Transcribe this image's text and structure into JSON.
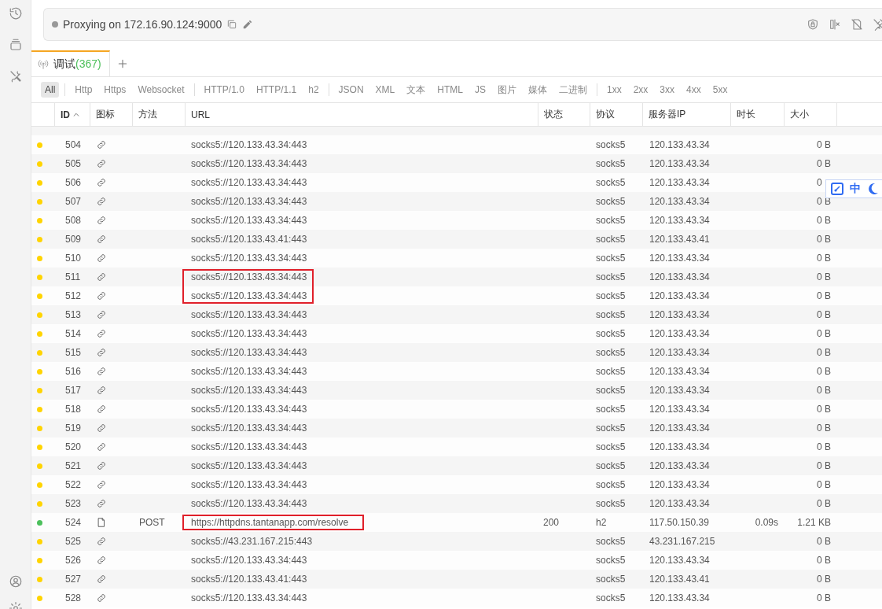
{
  "proxy_bar": {
    "status": "Proxying on 172.16.90.124:9000"
  },
  "tabs": [
    {
      "label": "调试",
      "count": "(367)",
      "selected": true
    }
  ],
  "filters": [
    {
      "separator": false,
      "label": "All",
      "selected": true
    },
    {
      "separator": true,
      "label": "Http",
      "selected": false
    },
    {
      "separator": false,
      "label": "Https",
      "selected": false
    },
    {
      "separator": false,
      "label": "Websocket",
      "selected": false
    },
    {
      "separator": true,
      "label": "HTTP/1.0",
      "selected": false
    },
    {
      "separator": false,
      "label": "HTTP/1.1",
      "selected": false
    },
    {
      "separator": false,
      "label": "h2",
      "selected": false
    },
    {
      "separator": true,
      "label": "JSON",
      "selected": false
    },
    {
      "separator": false,
      "label": "XML",
      "selected": false
    },
    {
      "separator": false,
      "label": "文本",
      "selected": false
    },
    {
      "separator": false,
      "label": "HTML",
      "selected": false
    },
    {
      "separator": false,
      "label": "JS",
      "selected": false
    },
    {
      "separator": false,
      "label": "图片",
      "selected": false
    },
    {
      "separator": false,
      "label": "媒体",
      "selected": false
    },
    {
      "separator": false,
      "label": "二进制",
      "selected": false
    },
    {
      "separator": true,
      "label": "1xx",
      "selected": false
    },
    {
      "separator": false,
      "label": "2xx",
      "selected": false
    },
    {
      "separator": false,
      "label": "3xx",
      "selected": false
    },
    {
      "separator": false,
      "label": "4xx",
      "selected": false
    },
    {
      "separator": false,
      "label": "5xx",
      "selected": false
    }
  ],
  "table": {
    "columns": [
      {
        "label": "ID",
        "sorted": true
      },
      {
        "label": "图标",
        "sorted": false
      },
      {
        "label": "方法",
        "sorted": false
      },
      {
        "label": "URL",
        "sorted": false
      },
      {
        "label": "状态",
        "sorted": false
      },
      {
        "label": "协议",
        "sorted": false
      },
      {
        "label": "服务器IP",
        "sorted": false
      },
      {
        "label": "时长",
        "sorted": false
      },
      {
        "label": "大小",
        "sorted": false
      }
    ],
    "rows": [
      {
        "id": "504",
        "kind": "tunnel",
        "color": "#ffd400",
        "method": "",
        "url": "socks5://120.133.43.34:443",
        "status": "",
        "protocol": "socks5",
        "ip": "120.133.43.34",
        "time": "",
        "size": "0 B",
        "boxed": false
      },
      {
        "id": "505",
        "kind": "tunnel",
        "color": "#ffd400",
        "method": "",
        "url": "socks5://120.133.43.34:443",
        "status": "",
        "protocol": "socks5",
        "ip": "120.133.43.34",
        "time": "",
        "size": "0 B",
        "boxed": false
      },
      {
        "id": "506",
        "kind": "tunnel",
        "color": "#ffd400",
        "method": "",
        "url": "socks5://120.133.43.34:443",
        "status": "",
        "protocol": "socks5",
        "ip": "120.133.43.34",
        "time": "",
        "size": "0",
        "boxed": false
      },
      {
        "id": "507",
        "kind": "tunnel",
        "color": "#ffd400",
        "method": "",
        "url": "socks5://120.133.43.34:443",
        "status": "",
        "protocol": "socks5",
        "ip": "120.133.43.34",
        "time": "",
        "size": "0 B",
        "boxed": false
      },
      {
        "id": "508",
        "kind": "tunnel",
        "color": "#ffd400",
        "method": "",
        "url": "socks5://120.133.43.34:443",
        "status": "",
        "protocol": "socks5",
        "ip": "120.133.43.34",
        "time": "",
        "size": "0 B",
        "boxed": false
      },
      {
        "id": "509",
        "kind": "tunnel",
        "color": "#ffd400",
        "method": "",
        "url": "socks5://120.133.43.41:443",
        "status": "",
        "protocol": "socks5",
        "ip": "120.133.43.41",
        "time": "",
        "size": "0 B",
        "boxed": false
      },
      {
        "id": "510",
        "kind": "tunnel",
        "color": "#ffd400",
        "method": "",
        "url": "socks5://120.133.43.34:443",
        "status": "",
        "protocol": "socks5",
        "ip": "120.133.43.34",
        "time": "",
        "size": "0 B",
        "boxed": false
      },
      {
        "id": "511",
        "kind": "tunnel",
        "color": "#ffd400",
        "method": "",
        "url": "socks5://120.133.43.34:443",
        "status": "",
        "protocol": "socks5",
        "ip": "120.133.43.34",
        "time": "",
        "size": "0 B",
        "boxed": true
      },
      {
        "id": "512",
        "kind": "tunnel",
        "color": "#ffd400",
        "method": "",
        "url": "socks5://120.133.43.34:443",
        "status": "",
        "protocol": "socks5",
        "ip": "120.133.43.34",
        "time": "",
        "size": "0 B",
        "boxed": true
      },
      {
        "id": "513",
        "kind": "tunnel",
        "color": "#ffd400",
        "method": "",
        "url": "socks5://120.133.43.34:443",
        "status": "",
        "protocol": "socks5",
        "ip": "120.133.43.34",
        "time": "",
        "size": "0 B",
        "boxed": false
      },
      {
        "id": "514",
        "kind": "tunnel",
        "color": "#ffd400",
        "method": "",
        "url": "socks5://120.133.43.34:443",
        "status": "",
        "protocol": "socks5",
        "ip": "120.133.43.34",
        "time": "",
        "size": "0 B",
        "boxed": false
      },
      {
        "id": "515",
        "kind": "tunnel",
        "color": "#ffd400",
        "method": "",
        "url": "socks5://120.133.43.34:443",
        "status": "",
        "protocol": "socks5",
        "ip": "120.133.43.34",
        "time": "",
        "size": "0 B",
        "boxed": false
      },
      {
        "id": "516",
        "kind": "tunnel",
        "color": "#ffd400",
        "method": "",
        "url": "socks5://120.133.43.34:443",
        "status": "",
        "protocol": "socks5",
        "ip": "120.133.43.34",
        "time": "",
        "size": "0 B",
        "boxed": false
      },
      {
        "id": "517",
        "kind": "tunnel",
        "color": "#ffd400",
        "method": "",
        "url": "socks5://120.133.43.34:443",
        "status": "",
        "protocol": "socks5",
        "ip": "120.133.43.34",
        "time": "",
        "size": "0 B",
        "boxed": false
      },
      {
        "id": "518",
        "kind": "tunnel",
        "color": "#ffd400",
        "method": "",
        "url": "socks5://120.133.43.34:443",
        "status": "",
        "protocol": "socks5",
        "ip": "120.133.43.34",
        "time": "",
        "size": "0 B",
        "boxed": false
      },
      {
        "id": "519",
        "kind": "tunnel",
        "color": "#ffd400",
        "method": "",
        "url": "socks5://120.133.43.34:443",
        "status": "",
        "protocol": "socks5",
        "ip": "120.133.43.34",
        "time": "",
        "size": "0 B",
        "boxed": false
      },
      {
        "id": "520",
        "kind": "tunnel",
        "color": "#ffd400",
        "method": "",
        "url": "socks5://120.133.43.34:443",
        "status": "",
        "protocol": "socks5",
        "ip": "120.133.43.34",
        "time": "",
        "size": "0 B",
        "boxed": false
      },
      {
        "id": "521",
        "kind": "tunnel",
        "color": "#ffd400",
        "method": "",
        "url": "socks5://120.133.43.34:443",
        "status": "",
        "protocol": "socks5",
        "ip": "120.133.43.34",
        "time": "",
        "size": "0 B",
        "boxed": false
      },
      {
        "id": "522",
        "kind": "tunnel",
        "color": "#ffd400",
        "method": "",
        "url": "socks5://120.133.43.34:443",
        "status": "",
        "protocol": "socks5",
        "ip": "120.133.43.34",
        "time": "",
        "size": "0 B",
        "boxed": false
      },
      {
        "id": "523",
        "kind": "tunnel",
        "color": "#ffd400",
        "method": "",
        "url": "socks5://120.133.43.34:443",
        "status": "",
        "protocol": "socks5",
        "ip": "120.133.43.34",
        "time": "",
        "size": "0 B",
        "boxed": false
      },
      {
        "id": "524",
        "kind": "document",
        "color": "#4cc05c",
        "method": "POST",
        "url": "https://httpdns.tantanapp.com/resolve",
        "status": "200",
        "protocol": "h2",
        "ip": "117.50.150.39",
        "time": "0.09s",
        "size": "1.21 KB",
        "boxed": true
      },
      {
        "id": "525",
        "kind": "tunnel",
        "color": "#ffd400",
        "method": "",
        "url": "socks5://43.231.167.215:443",
        "status": "",
        "protocol": "socks5",
        "ip": "43.231.167.215",
        "time": "",
        "size": "0 B",
        "boxed": false
      },
      {
        "id": "526",
        "kind": "tunnel",
        "color": "#ffd400",
        "method": "",
        "url": "socks5://120.133.43.34:443",
        "status": "",
        "protocol": "socks5",
        "ip": "120.133.43.34",
        "time": "",
        "size": "0 B",
        "boxed": false
      },
      {
        "id": "527",
        "kind": "tunnel",
        "color": "#ffd400",
        "method": "",
        "url": "socks5://120.133.43.41:443",
        "status": "",
        "protocol": "socks5",
        "ip": "120.133.43.41",
        "time": "",
        "size": "0 B",
        "boxed": false
      },
      {
        "id": "528",
        "kind": "tunnel",
        "color": "#ffd400",
        "method": "",
        "url": "socks5://120.133.43.34:443",
        "status": "",
        "protocol": "socks5",
        "ip": "120.133.43.34",
        "time": "",
        "size": "0 B",
        "boxed": false
      }
    ]
  },
  "ime_widget": {
    "label": "中"
  }
}
